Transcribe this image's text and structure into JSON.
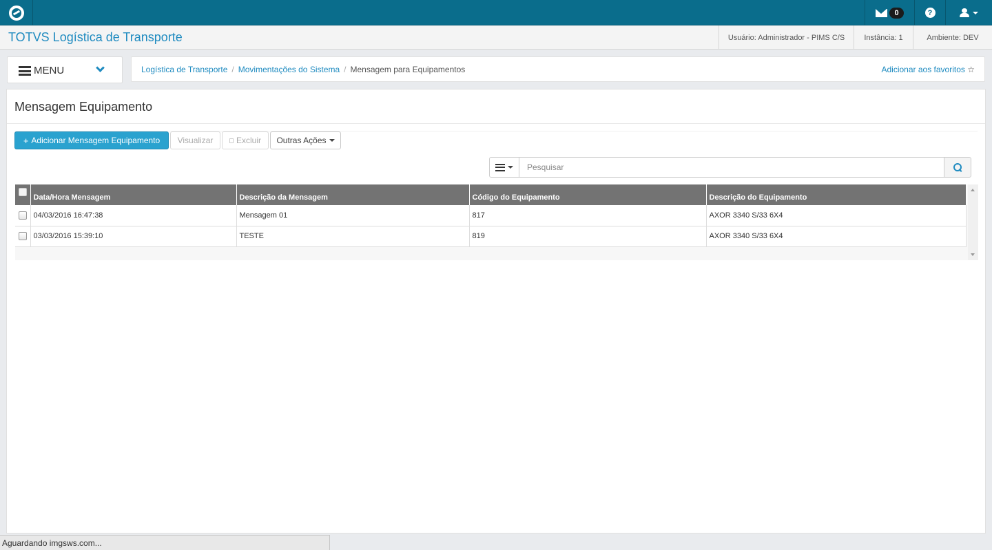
{
  "topbar": {
    "logo_icon": "totvs-logo-icon",
    "mail_count": "0",
    "help_glyph": "?"
  },
  "header": {
    "app_title": "TOTVS Logística de Transporte",
    "user": "Usuário: Administrador - PIMS C/S",
    "instance": "Instância: 1",
    "environment": "Ambiente: DEV"
  },
  "menu": {
    "label": "MENU"
  },
  "breadcrumb": {
    "items": [
      "Logística de Transporte",
      "Movimentações do Sistema"
    ],
    "current": "Mensagem para Equipamentos",
    "separator": "/",
    "favorites": "Adicionar aos favoritos",
    "star": "☆"
  },
  "page": {
    "title": "Mensagem Equipamento",
    "buttons": {
      "add": "Adicionar Mensagem Equipamento",
      "add_glyph": "+",
      "view": "Visualizar",
      "delete": "Excluir",
      "more": "Outras Ações"
    },
    "search": {
      "placeholder": "Pesquisar"
    }
  },
  "grid": {
    "columns": [
      "Data/Hora Mensagem",
      "Descrição da Mensagem",
      "Código do Equipamento",
      "Descrição do Equipamento"
    ],
    "rows": [
      [
        "04/03/2016 16:47:38",
        "Mensagem 01",
        "817",
        "AXOR 3340 S/33 6X4"
      ],
      [
        "03/03/2016 15:39:10",
        "TESTE",
        "819",
        "AXOR 3340 S/33 6X4"
      ]
    ]
  },
  "status": {
    "text": "Aguardando imgsws.com..."
  },
  "colors": {
    "topbar": "#0a6d8c",
    "accent": "#1f8bc0",
    "primary_button": "#2aa2cf",
    "grid_header": "#737373"
  }
}
